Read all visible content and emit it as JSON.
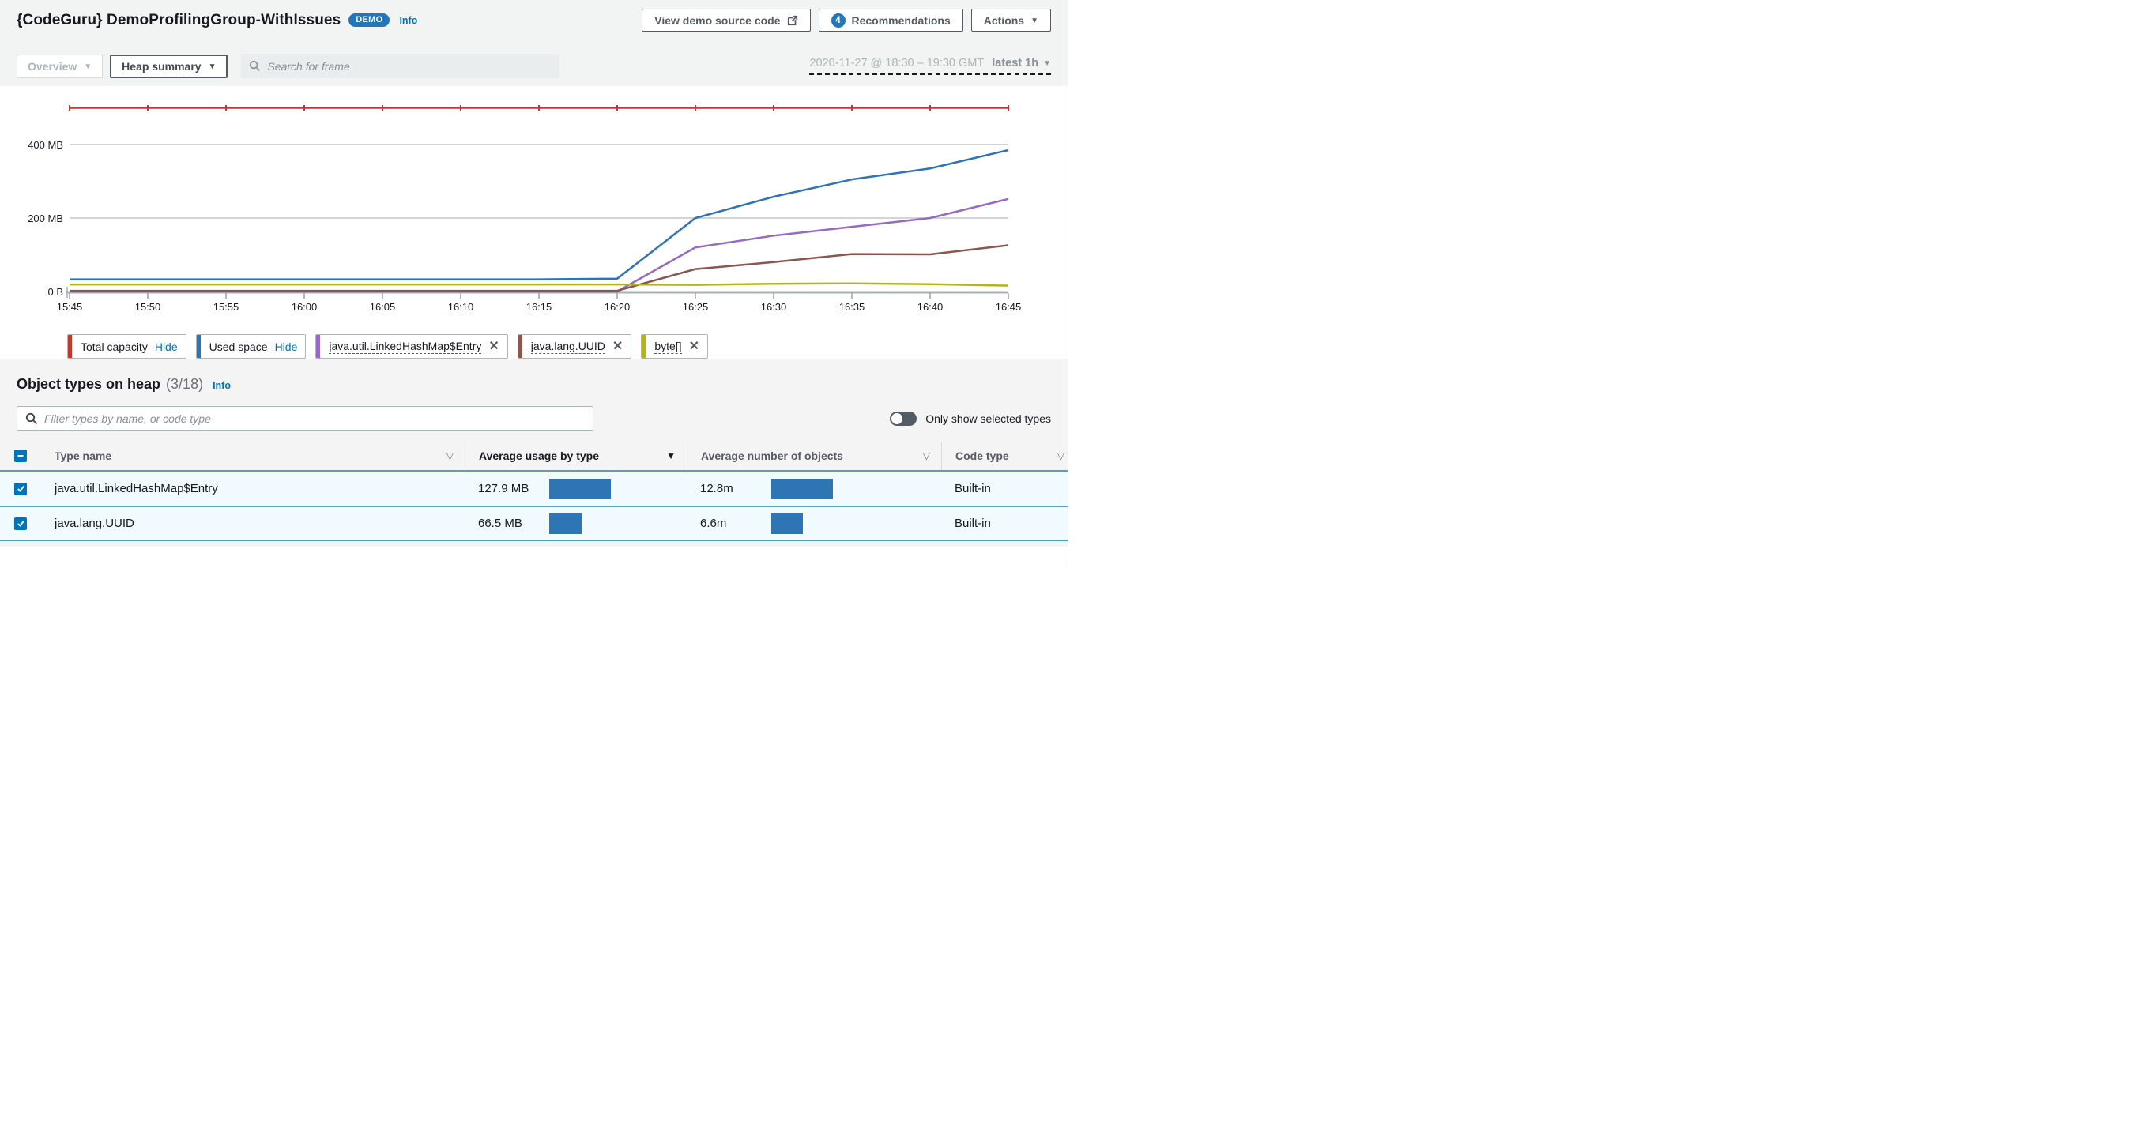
{
  "header": {
    "title": "{CodeGuru} DemoProfilingGroup-WithIssues",
    "demo_badge": "DEMO",
    "info_label": "Info",
    "view_source_button": "View demo source code",
    "recommendations_count": "4",
    "recommendations_button": "Recommendations",
    "actions_button": "Actions"
  },
  "toolbar": {
    "overview_dropdown": "Overview",
    "view_dropdown": "Heap summary",
    "search_placeholder": "Search for frame",
    "date_range": "2020-11-27 @ 18:30 – 19:30 GMT",
    "range_preset": "latest 1h"
  },
  "chart_data": {
    "type": "line",
    "title": "Heap summary over time",
    "x": [
      "15:45",
      "15:50",
      "15:55",
      "16:00",
      "16:05",
      "16:10",
      "16:15",
      "16:20",
      "16:25",
      "16:30",
      "16:35",
      "16:40",
      "16:45"
    ],
    "y_ticks": [
      {
        "value": 0,
        "label": "0 B"
      },
      {
        "value": 200,
        "label": "200 MB"
      },
      {
        "value": 400,
        "label": "400 MB"
      }
    ],
    "ylim": [
      0,
      540
    ],
    "unit": "MB",
    "grid": true,
    "legend_position": "bottom",
    "series": [
      {
        "name": "Total capacity",
        "color": "#c5362c",
        "markers": true,
        "values": [
          500,
          500,
          500,
          500,
          500,
          500,
          500,
          500,
          500,
          500,
          500,
          500,
          500
        ]
      },
      {
        "name": "Used space",
        "color": "#2e73b8",
        "markers": false,
        "values": [
          33,
          33,
          33,
          33,
          33,
          33,
          33,
          35,
          200,
          258,
          305,
          335,
          385
        ]
      },
      {
        "name": "java.util.LinkedHashMap$Entry",
        "color": "#9469c7",
        "markers": false,
        "values": [
          0,
          0,
          0,
          0,
          0,
          0,
          0,
          0,
          120,
          152,
          176,
          200,
          252
        ]
      },
      {
        "name": "java.lang.UUID",
        "color": "#8a564e",
        "markers": false,
        "values": [
          2,
          2,
          2,
          2,
          2,
          2,
          2,
          2,
          61,
          80,
          102,
          101,
          126
        ]
      },
      {
        "name": "byte[]",
        "color": "#b2b322",
        "markers": false,
        "values": [
          19,
          19,
          19,
          19,
          19,
          19,
          19,
          19,
          18,
          21,
          22,
          20,
          16
        ]
      }
    ]
  },
  "legend": {
    "items": [
      {
        "label": "Total capacity",
        "color": "#c5362c",
        "kind": "hide",
        "action_label": "Hide"
      },
      {
        "label": "Used space",
        "color": "#2e73b8",
        "kind": "hide",
        "action_label": "Hide"
      },
      {
        "label": "java.util.LinkedHashMap$Entry",
        "color": "#9469c7",
        "kind": "remove"
      },
      {
        "label": "java.lang.UUID",
        "color": "#8a564e",
        "kind": "remove"
      },
      {
        "label": "byte[]",
        "color": "#b2b322",
        "kind": "remove"
      }
    ]
  },
  "object_types": {
    "heading": "Object types on heap",
    "count": "(3/18)",
    "info_label": "Info",
    "filter_placeholder": "Filter types by name, or code type",
    "toggle_label": "Only show selected types",
    "columns": [
      {
        "label": "Type name",
        "sort": "none"
      },
      {
        "label": "Average usage by type",
        "sort": "desc"
      },
      {
        "label": "Average number of objects",
        "sort": "none"
      },
      {
        "label": "Code type",
        "sort": "none"
      }
    ],
    "bar_color": "#2e75b6",
    "max_usage_mb": 127.9,
    "max_objects_m": 12.8,
    "rows": [
      {
        "type_name": "java.util.LinkedHashMap$Entry",
        "usage_label": "127.9 MB",
        "usage_mb": 127.9,
        "objects_label": "12.8m",
        "objects_m": 12.8,
        "code_type": "Built-in",
        "selected": true
      },
      {
        "type_name": "java.lang.UUID",
        "usage_label": "66.5 MB",
        "usage_mb": 66.5,
        "objects_label": "6.6m",
        "objects_m": 6.6,
        "code_type": "Built-in",
        "selected": true
      }
    ]
  }
}
